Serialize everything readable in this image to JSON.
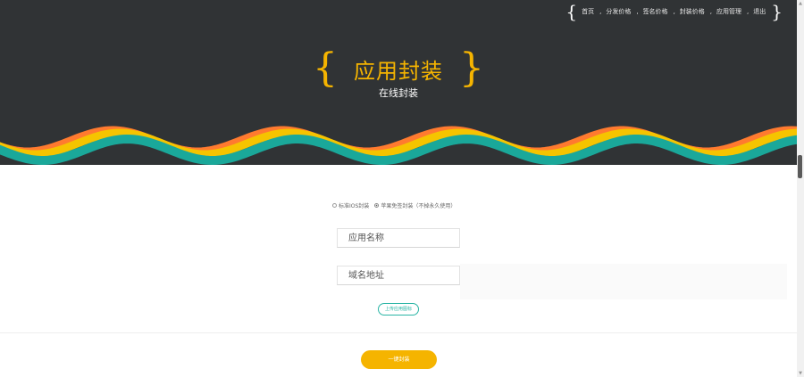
{
  "nav": {
    "items": [
      {
        "label": "首页"
      },
      {
        "label": "分发价格"
      },
      {
        "label": "签名价格"
      },
      {
        "label": "封装价格"
      },
      {
        "label": "应用管理"
      },
      {
        "label": "退出"
      }
    ],
    "separator": ","
  },
  "hero": {
    "title": "应用封装",
    "subtitle": "在线封装",
    "brace_left": "{",
    "brace_right": "}",
    "accent_color": "#f5b400"
  },
  "form": {
    "radio_options": [
      {
        "label": "标准IOS封装",
        "checked": false
      },
      {
        "label": "苹果免签封装（不掉永久使用）",
        "checked": true
      }
    ],
    "app_name": {
      "placeholder": "应用名称",
      "value": ""
    },
    "domain": {
      "placeholder": "域名地址",
      "value": ""
    },
    "upload_label": "上传应用图标",
    "submit_label": "一键封装"
  },
  "wave_colors": [
    "#1aa89a",
    "#f5c400",
    "#ff7a2f"
  ],
  "scrollbar": {
    "up": "▲",
    "down": "▼"
  }
}
